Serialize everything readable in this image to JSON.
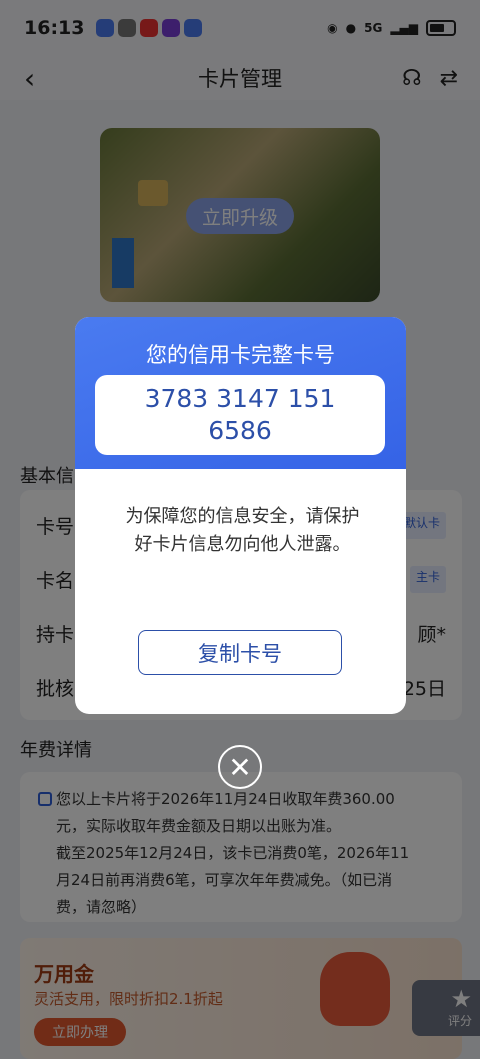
{
  "status": {
    "time": "16:13",
    "network": "5G"
  },
  "header": {
    "title": "卡片管理",
    "back_icon": "‹",
    "service_icon": "headset-icon",
    "switch_icon": "switch-icon"
  },
  "card": {
    "upgrade_label": "立即升级"
  },
  "basic": {
    "title": "基本信",
    "rows": [
      {
        "label": "卡号",
        "value": "默认卡"
      },
      {
        "label": "卡名",
        "value": "主卡"
      },
      {
        "label": "持卡",
        "value": "顾*"
      },
      {
        "label": "批核",
        "value": "25日"
      }
    ]
  },
  "fee": {
    "title": "年费详情",
    "lines": [
      "您以上卡片将于2026年11月24日收取年费360.00",
      "元，实际收取年费金额及日期以出账为准。",
      "截至2025年12月24日，该卡已消费0笔，2026年11",
      "月24日前再消费6笔，可享次年年费减免。（如已消",
      "费，请忽略）"
    ]
  },
  "promo": {
    "title": "万用金",
    "subtitle": "灵活支用，限时折扣2.1折起",
    "button": "立即办理"
  },
  "rating": {
    "label": "评分"
  },
  "modal": {
    "title": "您的信用卡完整卡号",
    "card_number": "3783 3147 151 6586",
    "notice": "为保障您的信息安全，请保护好卡片信息勿向他人泄露。",
    "copy_label": "复制卡号",
    "close_icon": "close-icon"
  },
  "colors": {
    "primary": "#3563e6",
    "accent": "#2c4fa8",
    "promo": "#e2582f"
  }
}
